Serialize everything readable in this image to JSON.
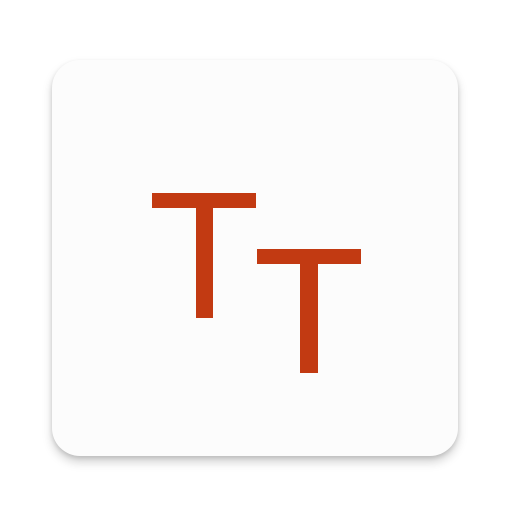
{
  "app_icon": {
    "glyph_color": "#c23a12",
    "tile_color": "#fcfcfc",
    "glyph_large_letter": "T",
    "glyph_small_letter": "T"
  }
}
